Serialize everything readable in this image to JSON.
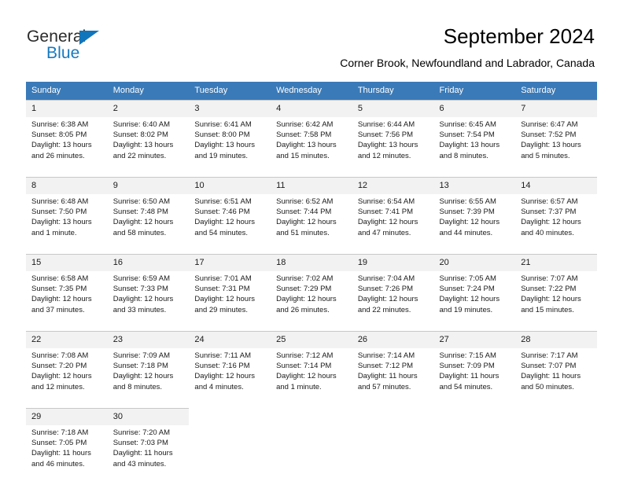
{
  "brand": {
    "word_one": "General",
    "word_two": "Blue",
    "triangle_color": "#1175bc",
    "blue_color": "#1579c0"
  },
  "header": {
    "title": "September 2024",
    "subtitle": "Corner Brook, Newfoundland and Labrador, Canada",
    "header_bg": "#3a7ab8",
    "daynum_bg": "#f2f2f2"
  },
  "weekday_headers": [
    "Sunday",
    "Monday",
    "Tuesday",
    "Wednesday",
    "Thursday",
    "Friday",
    "Saturday"
  ],
  "weeks": [
    {
      "days": [
        {
          "num": "1",
          "sunrise": "Sunrise: 6:38 AM",
          "sunset": "Sunset: 8:05 PM",
          "daylight_1": "Daylight: 13 hours",
          "daylight_2": "and 26 minutes."
        },
        {
          "num": "2",
          "sunrise": "Sunrise: 6:40 AM",
          "sunset": "Sunset: 8:02 PM",
          "daylight_1": "Daylight: 13 hours",
          "daylight_2": "and 22 minutes."
        },
        {
          "num": "3",
          "sunrise": "Sunrise: 6:41 AM",
          "sunset": "Sunset: 8:00 PM",
          "daylight_1": "Daylight: 13 hours",
          "daylight_2": "and 19 minutes."
        },
        {
          "num": "4",
          "sunrise": "Sunrise: 6:42 AM",
          "sunset": "Sunset: 7:58 PM",
          "daylight_1": "Daylight: 13 hours",
          "daylight_2": "and 15 minutes."
        },
        {
          "num": "5",
          "sunrise": "Sunrise: 6:44 AM",
          "sunset": "Sunset: 7:56 PM",
          "daylight_1": "Daylight: 13 hours",
          "daylight_2": "and 12 minutes."
        },
        {
          "num": "6",
          "sunrise": "Sunrise: 6:45 AM",
          "sunset": "Sunset: 7:54 PM",
          "daylight_1": "Daylight: 13 hours",
          "daylight_2": "and 8 minutes."
        },
        {
          "num": "7",
          "sunrise": "Sunrise: 6:47 AM",
          "sunset": "Sunset: 7:52 PM",
          "daylight_1": "Daylight: 13 hours",
          "daylight_2": "and 5 minutes."
        }
      ]
    },
    {
      "days": [
        {
          "num": "8",
          "sunrise": "Sunrise: 6:48 AM",
          "sunset": "Sunset: 7:50 PM",
          "daylight_1": "Daylight: 13 hours",
          "daylight_2": "and 1 minute."
        },
        {
          "num": "9",
          "sunrise": "Sunrise: 6:50 AM",
          "sunset": "Sunset: 7:48 PM",
          "daylight_1": "Daylight: 12 hours",
          "daylight_2": "and 58 minutes."
        },
        {
          "num": "10",
          "sunrise": "Sunrise: 6:51 AM",
          "sunset": "Sunset: 7:46 PM",
          "daylight_1": "Daylight: 12 hours",
          "daylight_2": "and 54 minutes."
        },
        {
          "num": "11",
          "sunrise": "Sunrise: 6:52 AM",
          "sunset": "Sunset: 7:44 PM",
          "daylight_1": "Daylight: 12 hours",
          "daylight_2": "and 51 minutes."
        },
        {
          "num": "12",
          "sunrise": "Sunrise: 6:54 AM",
          "sunset": "Sunset: 7:41 PM",
          "daylight_1": "Daylight: 12 hours",
          "daylight_2": "and 47 minutes."
        },
        {
          "num": "13",
          "sunrise": "Sunrise: 6:55 AM",
          "sunset": "Sunset: 7:39 PM",
          "daylight_1": "Daylight: 12 hours",
          "daylight_2": "and 44 minutes."
        },
        {
          "num": "14",
          "sunrise": "Sunrise: 6:57 AM",
          "sunset": "Sunset: 7:37 PM",
          "daylight_1": "Daylight: 12 hours",
          "daylight_2": "and 40 minutes."
        }
      ]
    },
    {
      "days": [
        {
          "num": "15",
          "sunrise": "Sunrise: 6:58 AM",
          "sunset": "Sunset: 7:35 PM",
          "daylight_1": "Daylight: 12 hours",
          "daylight_2": "and 37 minutes."
        },
        {
          "num": "16",
          "sunrise": "Sunrise: 6:59 AM",
          "sunset": "Sunset: 7:33 PM",
          "daylight_1": "Daylight: 12 hours",
          "daylight_2": "and 33 minutes."
        },
        {
          "num": "17",
          "sunrise": "Sunrise: 7:01 AM",
          "sunset": "Sunset: 7:31 PM",
          "daylight_1": "Daylight: 12 hours",
          "daylight_2": "and 29 minutes."
        },
        {
          "num": "18",
          "sunrise": "Sunrise: 7:02 AM",
          "sunset": "Sunset: 7:29 PM",
          "daylight_1": "Daylight: 12 hours",
          "daylight_2": "and 26 minutes."
        },
        {
          "num": "19",
          "sunrise": "Sunrise: 7:04 AM",
          "sunset": "Sunset: 7:26 PM",
          "daylight_1": "Daylight: 12 hours",
          "daylight_2": "and 22 minutes."
        },
        {
          "num": "20",
          "sunrise": "Sunrise: 7:05 AM",
          "sunset": "Sunset: 7:24 PM",
          "daylight_1": "Daylight: 12 hours",
          "daylight_2": "and 19 minutes."
        },
        {
          "num": "21",
          "sunrise": "Sunrise: 7:07 AM",
          "sunset": "Sunset: 7:22 PM",
          "daylight_1": "Daylight: 12 hours",
          "daylight_2": "and 15 minutes."
        }
      ]
    },
    {
      "days": [
        {
          "num": "22",
          "sunrise": "Sunrise: 7:08 AM",
          "sunset": "Sunset: 7:20 PM",
          "daylight_1": "Daylight: 12 hours",
          "daylight_2": "and 12 minutes."
        },
        {
          "num": "23",
          "sunrise": "Sunrise: 7:09 AM",
          "sunset": "Sunset: 7:18 PM",
          "daylight_1": "Daylight: 12 hours",
          "daylight_2": "and 8 minutes."
        },
        {
          "num": "24",
          "sunrise": "Sunrise: 7:11 AM",
          "sunset": "Sunset: 7:16 PM",
          "daylight_1": "Daylight: 12 hours",
          "daylight_2": "and 4 minutes."
        },
        {
          "num": "25",
          "sunrise": "Sunrise: 7:12 AM",
          "sunset": "Sunset: 7:14 PM",
          "daylight_1": "Daylight: 12 hours",
          "daylight_2": "and 1 minute."
        },
        {
          "num": "26",
          "sunrise": "Sunrise: 7:14 AM",
          "sunset": "Sunset: 7:12 PM",
          "daylight_1": "Daylight: 11 hours",
          "daylight_2": "and 57 minutes."
        },
        {
          "num": "27",
          "sunrise": "Sunrise: 7:15 AM",
          "sunset": "Sunset: 7:09 PM",
          "daylight_1": "Daylight: 11 hours",
          "daylight_2": "and 54 minutes."
        },
        {
          "num": "28",
          "sunrise": "Sunrise: 7:17 AM",
          "sunset": "Sunset: 7:07 PM",
          "daylight_1": "Daylight: 11 hours",
          "daylight_2": "and 50 minutes."
        }
      ]
    },
    {
      "days": [
        {
          "num": "29",
          "sunrise": "Sunrise: 7:18 AM",
          "sunset": "Sunset: 7:05 PM",
          "daylight_1": "Daylight: 11 hours",
          "daylight_2": "and 46 minutes."
        },
        {
          "num": "30",
          "sunrise": "Sunrise: 7:20 AM",
          "sunset": "Sunset: 7:03 PM",
          "daylight_1": "Daylight: 11 hours",
          "daylight_2": "and 43 minutes."
        },
        {
          "num": "",
          "sunrise": "",
          "sunset": "",
          "daylight_1": "",
          "daylight_2": ""
        },
        {
          "num": "",
          "sunrise": "",
          "sunset": "",
          "daylight_1": "",
          "daylight_2": ""
        },
        {
          "num": "",
          "sunrise": "",
          "sunset": "",
          "daylight_1": "",
          "daylight_2": ""
        },
        {
          "num": "",
          "sunrise": "",
          "sunset": "",
          "daylight_1": "",
          "daylight_2": ""
        },
        {
          "num": "",
          "sunrise": "",
          "sunset": "",
          "daylight_1": "",
          "daylight_2": ""
        }
      ]
    }
  ]
}
